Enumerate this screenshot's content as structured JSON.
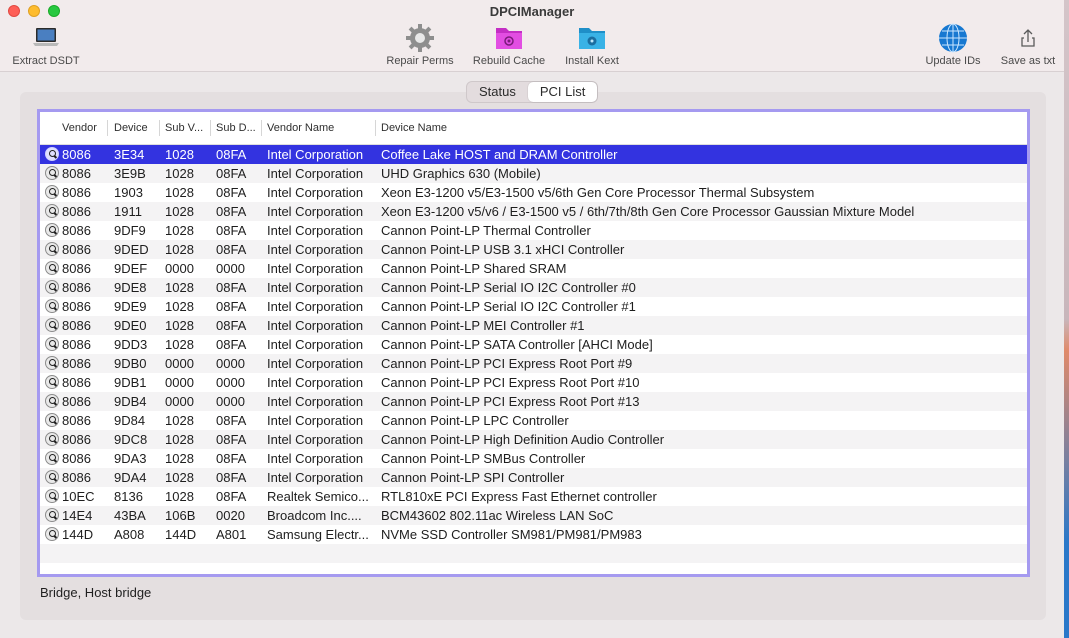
{
  "window": {
    "title": "DPCIManager"
  },
  "toolbar": {
    "extract_dsdt": "Extract DSDT",
    "repair_perms": "Repair Perms",
    "rebuild_cache": "Rebuild Cache",
    "install_kext": "Install Kext",
    "update_ids": "Update IDs",
    "save_as_txt": "Save as txt"
  },
  "tabs": {
    "status": "Status",
    "pci_list": "PCI List",
    "active": "PCI List"
  },
  "table": {
    "headers": [
      "Vendor",
      "Device",
      "Sub V...",
      "Sub D...",
      "Vendor Name",
      "Device Name"
    ],
    "selected_index": 0,
    "rows": [
      [
        "8086",
        "3E34",
        "1028",
        "08FA",
        "Intel Corporation",
        "Coffee Lake HOST and DRAM Controller"
      ],
      [
        "8086",
        "3E9B",
        "1028",
        "08FA",
        "Intel Corporation",
        "UHD Graphics 630 (Mobile)"
      ],
      [
        "8086",
        "1903",
        "1028",
        "08FA",
        "Intel Corporation",
        "Xeon E3-1200 v5/E3-1500 v5/6th Gen Core Processor Thermal Subsystem"
      ],
      [
        "8086",
        "1911",
        "1028",
        "08FA",
        "Intel Corporation",
        "Xeon E3-1200 v5/v6 / E3-1500 v5 / 6th/7th/8th Gen Core Processor Gaussian Mixture Model"
      ],
      [
        "8086",
        "9DF9",
        "1028",
        "08FA",
        "Intel Corporation",
        "Cannon Point-LP Thermal Controller"
      ],
      [
        "8086",
        "9DED",
        "1028",
        "08FA",
        "Intel Corporation",
        "Cannon Point-LP USB 3.1 xHCI Controller"
      ],
      [
        "8086",
        "9DEF",
        "0000",
        "0000",
        "Intel Corporation",
        "Cannon Point-LP Shared SRAM"
      ],
      [
        "8086",
        "9DE8",
        "1028",
        "08FA",
        "Intel Corporation",
        "Cannon Point-LP Serial IO I2C Controller #0"
      ],
      [
        "8086",
        "9DE9",
        "1028",
        "08FA",
        "Intel Corporation",
        "Cannon Point-LP Serial IO I2C Controller #1"
      ],
      [
        "8086",
        "9DE0",
        "1028",
        "08FA",
        "Intel Corporation",
        "Cannon Point-LP MEI Controller #1"
      ],
      [
        "8086",
        "9DD3",
        "1028",
        "08FA",
        "Intel Corporation",
        "Cannon Point-LP SATA Controller [AHCI Mode]"
      ],
      [
        "8086",
        "9DB0",
        "0000",
        "0000",
        "Intel Corporation",
        "Cannon Point-LP PCI Express Root Port #9"
      ],
      [
        "8086",
        "9DB1",
        "0000",
        "0000",
        "Intel Corporation",
        "Cannon Point-LP PCI Express Root Port #10"
      ],
      [
        "8086",
        "9DB4",
        "0000",
        "0000",
        "Intel Corporation",
        "Cannon Point-LP PCI Express Root Port #13"
      ],
      [
        "8086",
        "9D84",
        "1028",
        "08FA",
        "Intel Corporation",
        "Cannon Point-LP LPC Controller"
      ],
      [
        "8086",
        "9DC8",
        "1028",
        "08FA",
        "Intel Corporation",
        "Cannon Point-LP High Definition Audio Controller"
      ],
      [
        "8086",
        "9DA3",
        "1028",
        "08FA",
        "Intel Corporation",
        "Cannon Point-LP SMBus Controller"
      ],
      [
        "8086",
        "9DA4",
        "1028",
        "08FA",
        "Intel Corporation",
        "Cannon Point-LP SPI Controller"
      ],
      [
        "10EC",
        "8136",
        "1028",
        "08FA",
        "Realtek Semico...",
        "RTL810xE PCI Express Fast Ethernet controller"
      ],
      [
        "14E4",
        "43BA",
        "106B",
        "0020",
        "Broadcom Inc....",
        "BCM43602 802.11ac Wireless LAN SoC"
      ],
      [
        "144D",
        "A808",
        "144D",
        "A801",
        "Samsung Electr...",
        "NVMe SSD Controller SM981/PM981/PM983"
      ]
    ]
  },
  "status_text": "Bridge, Host bridge",
  "colors": {
    "selection": "#3333e0",
    "focus_ring": "#a59af0",
    "accent_magenta": "#d43ad4",
    "accent_cyan": "#2aa6d6"
  },
  "icons": {
    "extract_dsdt": "laptop-icon",
    "repair_perms": "gear-icon",
    "rebuild_cache": "magenta-folder-icon",
    "install_kext": "blue-folder-icon",
    "update_ids": "globe-icon",
    "save_as_txt": "share-icon",
    "row": "magnifier-icon"
  }
}
